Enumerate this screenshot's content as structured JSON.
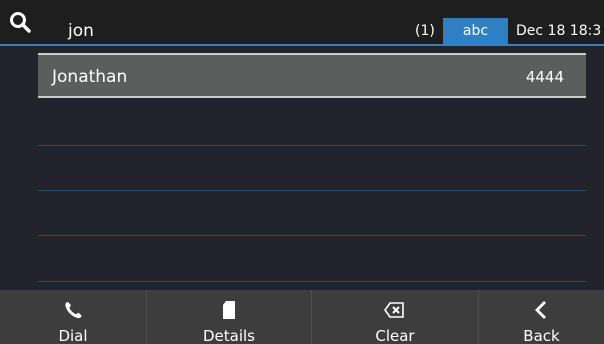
{
  "colors": {
    "background": "#23232b",
    "topbar": "#1e1e1e",
    "accent": "#2f7fc4",
    "selected_row": "#5a5e5c",
    "softkey_bar": "#3d3d3d",
    "text": "#ffffff"
  },
  "search": {
    "icon": "search-icon",
    "query": "jon",
    "result_count": "(1)",
    "input_mode": "abc",
    "datetime": "Dec 18 18:3"
  },
  "results": [
    {
      "name": "Jonathan",
      "number": "4444",
      "selected": true
    }
  ],
  "softkeys": [
    {
      "label": "Dial",
      "icon": "phone-icon"
    },
    {
      "label": "Details",
      "icon": "document-icon"
    },
    {
      "label": "Clear",
      "icon": "backspace-icon"
    },
    {
      "label": "Back",
      "icon": "chevron-left-icon"
    }
  ]
}
